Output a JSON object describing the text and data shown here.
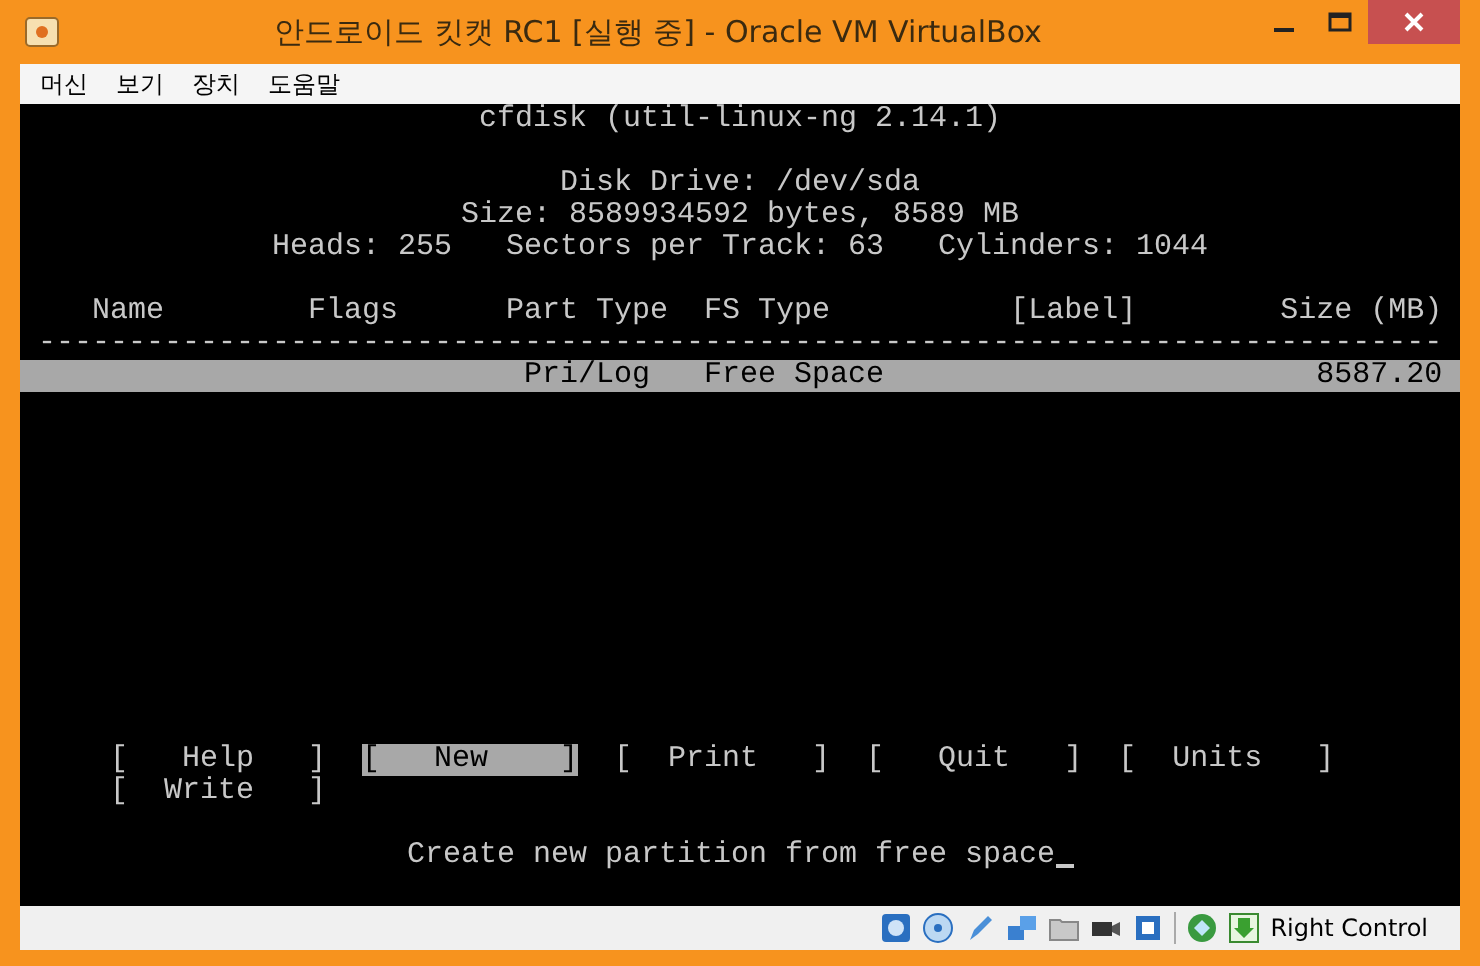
{
  "window": {
    "title": "안드로이드 킷캣 RC1 [실행 중] - Oracle VM VirtualBox"
  },
  "menu": [
    "머신",
    "보기",
    "장치",
    "도움말"
  ],
  "terminal": {
    "title": "cfdisk (util-linux-ng 2.14.1)",
    "info": [
      "Disk Drive: /dev/sda",
      "Size: 8589934592 bytes, 8589 MB",
      "Heads: 255   Sectors per Track: 63   Cylinders: 1044"
    ],
    "columns": [
      "Name",
      "Flags",
      "Part Type",
      "FS Type",
      "[Label]",
      "Size (MB)"
    ],
    "rule": "------------------------------------------------------------------------------",
    "rows": [
      {
        "selected": true,
        "cells": [
          "",
          "",
          "Pri/Log",
          "Free Space",
          "",
          "8587.20"
        ]
      }
    ],
    "buttons": [
      {
        "label": "[   Help   ]",
        "selected": false
      },
      {
        "label": "[   New    ]",
        "selected": true
      },
      {
        "label": "[  Print   ]",
        "selected": false
      },
      {
        "label": "[   Quit   ]",
        "selected": false
      },
      {
        "label": "[  Units   ]",
        "selected": false
      },
      {
        "label": "[  Write   ]",
        "selected": false
      }
    ],
    "message": "Create new partition from free space"
  },
  "status_bar": {
    "host_key": "Right Control"
  }
}
